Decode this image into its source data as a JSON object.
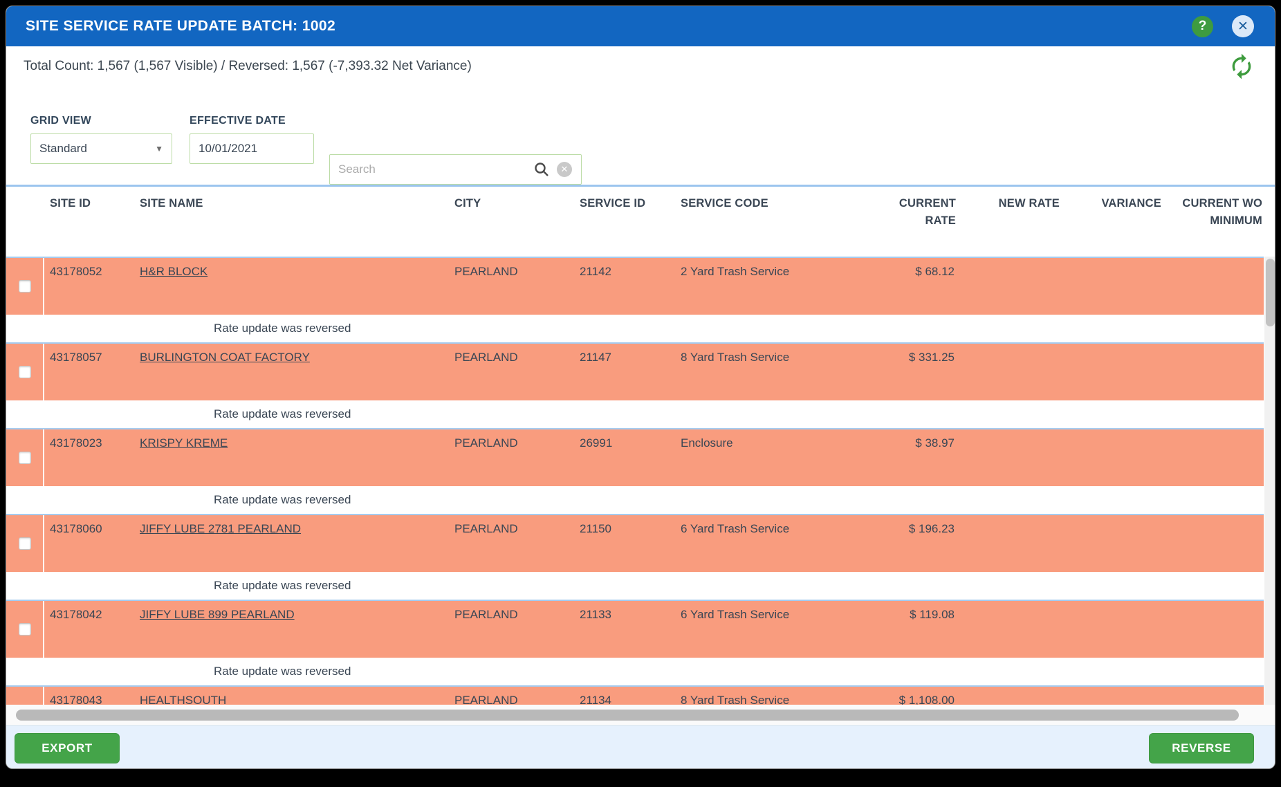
{
  "window": {
    "title": "SITE SERVICE RATE UPDATE BATCH: 1002"
  },
  "summary": {
    "text": "Total Count: 1,567 (1,567 Visible) / Reversed: 1,567 (-7,393.32 Net Variance)"
  },
  "filters": {
    "grid_view_label": "GRID VIEW",
    "grid_view_value": "Standard",
    "effective_date_label": "EFFECTIVE DATE",
    "effective_date_value": "10/01/2021",
    "search_placeholder": "Search"
  },
  "table": {
    "columns": [
      "SITE ID",
      "SITE NAME",
      "CITY",
      "SERVICE ID",
      "SERVICE CODE",
      "CURRENT RATE",
      "NEW RATE",
      "VARIANCE",
      "CURRENT WO MINIMUM"
    ],
    "reversed_message": "Rate update was reversed",
    "rows": [
      {
        "site_id": "43178052",
        "site_name": "H&R BLOCK",
        "city": "PEARLAND",
        "service_id": "21142",
        "service_code": "2 Yard Trash Service",
        "current_rate": "$ 68.12",
        "new_rate": "",
        "variance": "",
        "current_wo_minimum": "",
        "status": "Rate update was reversed"
      },
      {
        "site_id": "43178057",
        "site_name": "BURLINGTON COAT FACTORY",
        "city": "PEARLAND",
        "service_id": "21147",
        "service_code": "8 Yard Trash Service",
        "current_rate": "$ 331.25",
        "new_rate": "",
        "variance": "",
        "current_wo_minimum": "",
        "status": "Rate update was reversed"
      },
      {
        "site_id": "43178023",
        "site_name": "KRISPY KREME",
        "city": "PEARLAND",
        "service_id": "26991",
        "service_code": "Enclosure",
        "current_rate": "$ 38.97",
        "new_rate": "",
        "variance": "",
        "current_wo_minimum": "",
        "status": "Rate update was reversed"
      },
      {
        "site_id": "43178060",
        "site_name": "JIFFY LUBE 2781 PEARLAND",
        "city": "PEARLAND",
        "service_id": "21150",
        "service_code": "6 Yard Trash Service",
        "current_rate": "$ 196.23",
        "new_rate": "",
        "variance": "",
        "current_wo_minimum": "",
        "status": "Rate update was reversed"
      },
      {
        "site_id": "43178042",
        "site_name": "JIFFY LUBE 899 PEARLAND",
        "city": "PEARLAND",
        "service_id": "21133",
        "service_code": "6 Yard Trash Service",
        "current_rate": "$ 119.08",
        "new_rate": "",
        "variance": "",
        "current_wo_minimum": "",
        "status": "Rate update was reversed"
      },
      {
        "site_id": "43178043",
        "site_name": "HEALTHSOUTH",
        "city": "PEARLAND",
        "service_id": "21134",
        "service_code": "8 Yard Trash Service",
        "current_rate": "$ 1,108.00",
        "new_rate": "",
        "variance": "",
        "current_wo_minimum": "",
        "partial": true
      }
    ]
  },
  "footer": {
    "export_label": "EXPORT",
    "reverse_label": "REVERSE"
  },
  "icons": {
    "help_glyph": "?",
    "close_glyph": "✕",
    "clear_glyph": "✕",
    "dropdown_caret": "▼"
  },
  "colors": {
    "titlebar_blue": "#1266C1",
    "row_highlight_salmon": "#F99C7E",
    "divider_blue": "#A5CBEF",
    "button_green": "#44A449",
    "help_green": "#3E9B40",
    "footer_blue": "#E6F1FD",
    "input_border_green": "#BCDCA6",
    "text_slate": "#3A4654"
  }
}
